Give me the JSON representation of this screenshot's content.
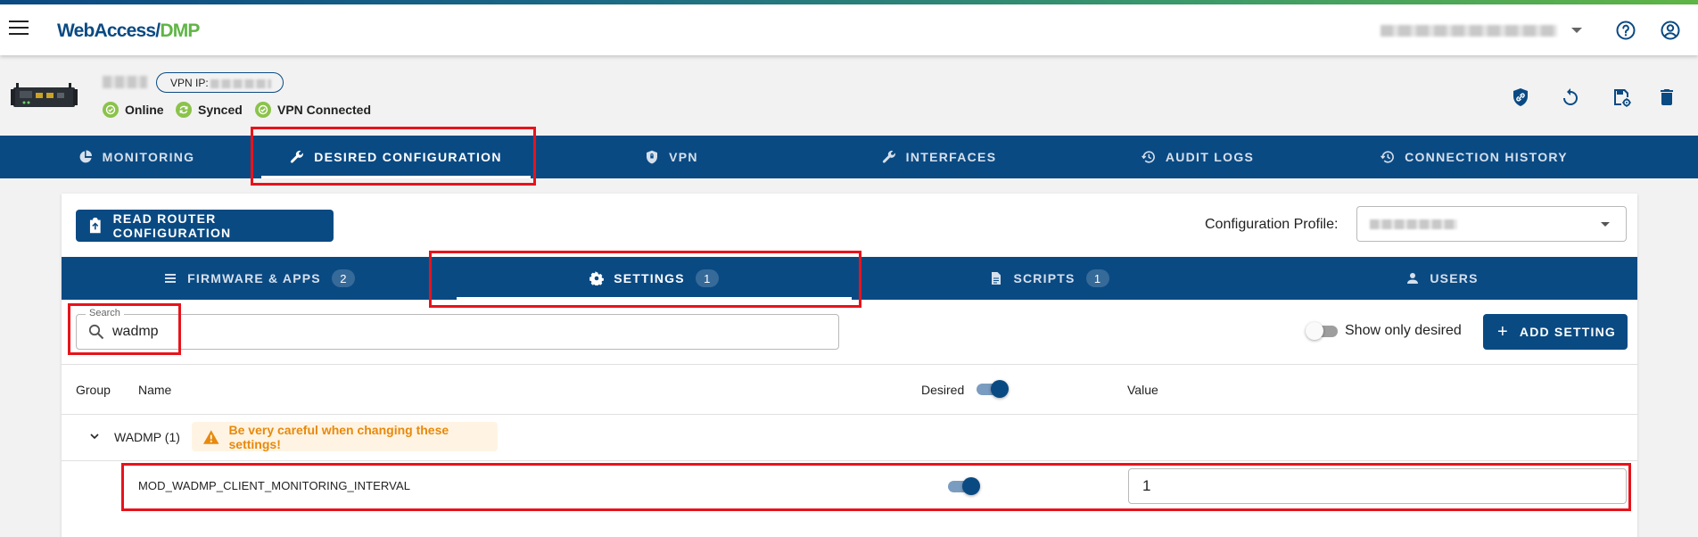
{
  "app": {
    "logo_part1": "WebAccess/",
    "logo_part2": "DMP"
  },
  "device": {
    "vpn_ip_label": "VPN IP:",
    "statuses": [
      {
        "label": "Online"
      },
      {
        "label": "Synced"
      },
      {
        "label": "VPN Connected"
      }
    ]
  },
  "main_tabs": [
    {
      "label": "MONITORING",
      "icon": "chart-pie-icon"
    },
    {
      "label": "DESIRED CONFIGURATION",
      "icon": "wrench-icon",
      "active": true
    },
    {
      "label": "VPN",
      "icon": "shield-icon"
    },
    {
      "label": "INTERFACES",
      "icon": "wrench-icon"
    },
    {
      "label": "AUDIT LOGS",
      "icon": "history-icon"
    },
    {
      "label": "CONNECTION HISTORY",
      "icon": "history-icon"
    }
  ],
  "config": {
    "read_button": "READ ROUTER CONFIGURATION",
    "profile_label": "Configuration Profile:",
    "sub_tabs": [
      {
        "label": "FIRMWARE & APPS",
        "count": "2",
        "icon": "stack-icon"
      },
      {
        "label": "SETTINGS",
        "count": "1",
        "icon": "gear-icon",
        "active": true
      },
      {
        "label": "SCRIPTS",
        "count": "1",
        "icon": "file-icon"
      },
      {
        "label": "USERS",
        "count": "",
        "icon": "person-icon"
      }
    ],
    "search": {
      "label": "Search",
      "value": "wadmp"
    },
    "show_only_desired_label": "Show only desired",
    "show_only_desired": false,
    "add_button": "ADD SETTING",
    "table": {
      "headers": {
        "group": "Group",
        "name": "Name",
        "desired": "Desired",
        "value": "Value"
      },
      "group_label": "WADMP (1)",
      "warning": "Be very careful when changing these settings!",
      "rows": [
        {
          "name": "MOD_WADMP_CLIENT_MONITORING_INTERVAL",
          "desired": true,
          "value": "1"
        }
      ]
    }
  },
  "colors": {
    "primary": "#0a4a83",
    "accent_green": "#5fb545",
    "status_green": "#8bc34a",
    "warning": "#e8890c",
    "highlight_red": "#e8131b"
  }
}
